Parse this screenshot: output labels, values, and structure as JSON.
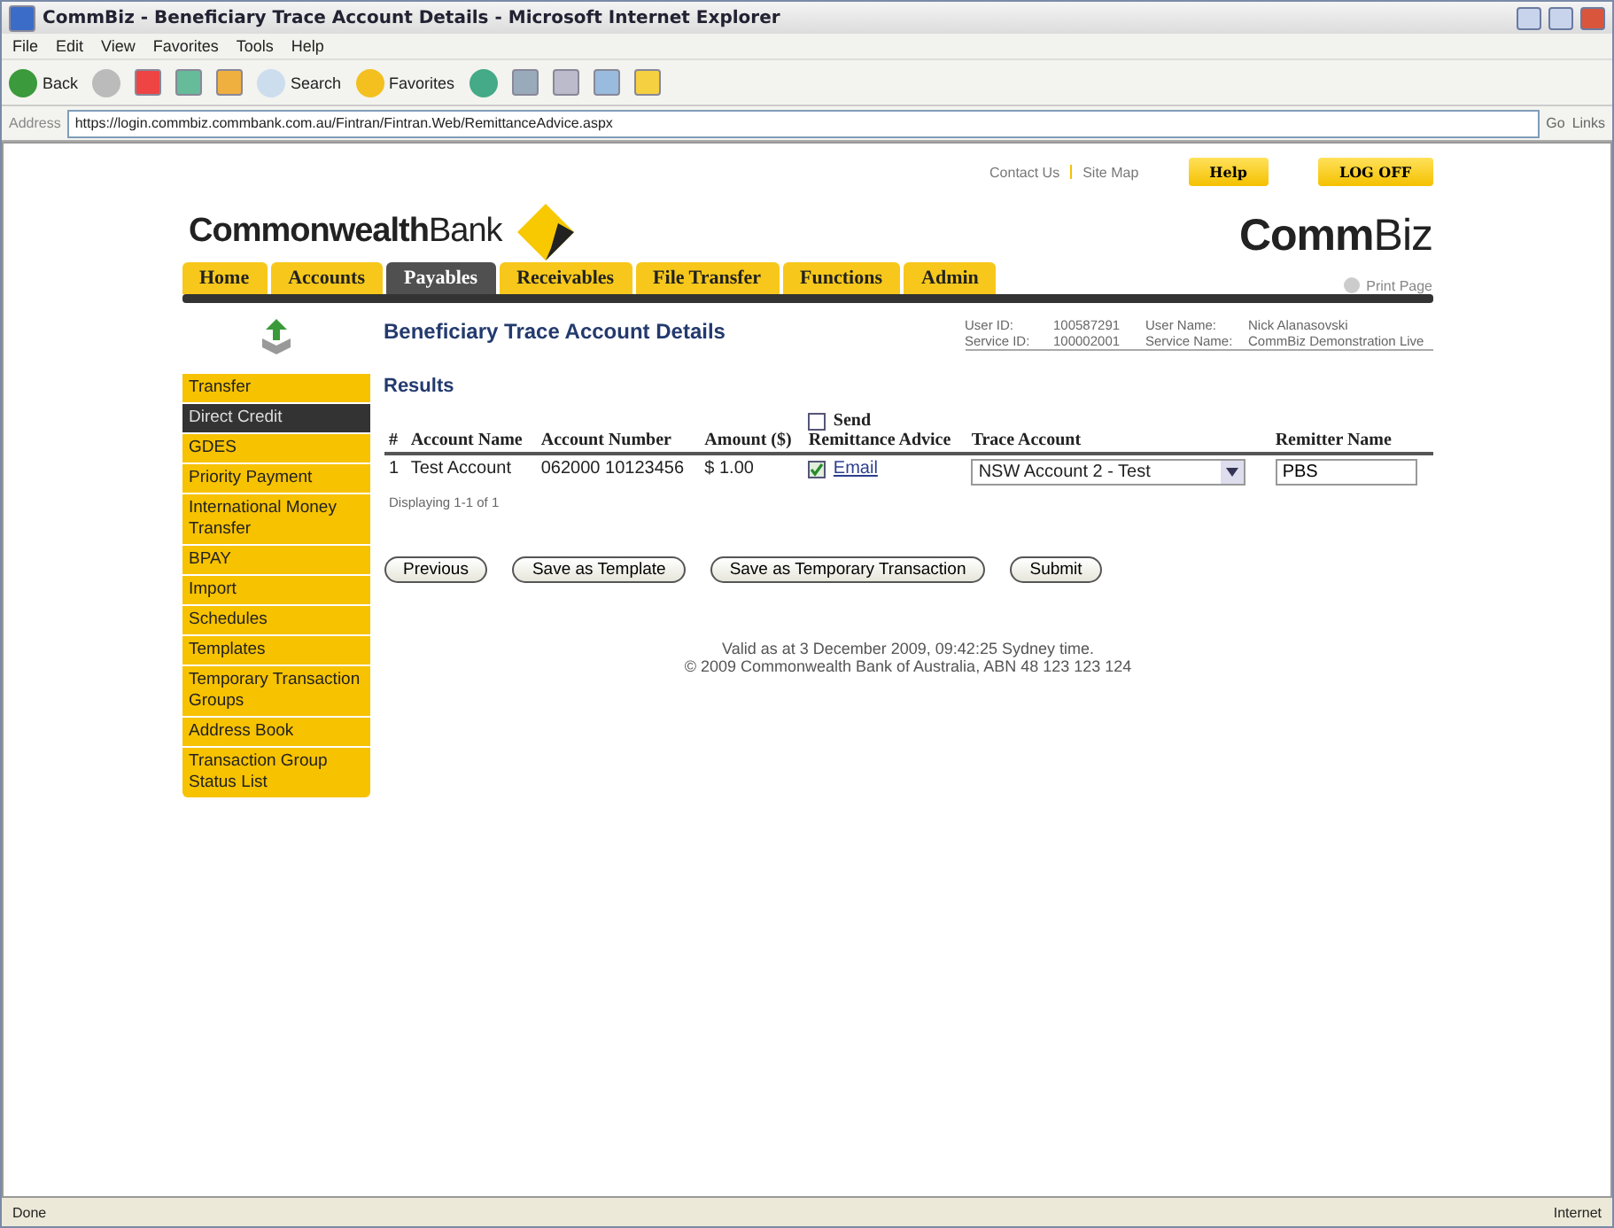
{
  "window": {
    "title": "CommBiz - Beneficiary Trace Account Details - Microsoft Internet Explorer"
  },
  "menu": [
    "File",
    "Edit",
    "View",
    "Favorites",
    "Tools",
    "Help"
  ],
  "toolbar": {
    "back": "Back",
    "search": "Search",
    "favorites": "Favorites"
  },
  "address": {
    "label": "Address",
    "url": "https://login.commbiz.commbank.com.au/Fintran/Fintran.Web/RemittanceAdvice.aspx",
    "go": "Go",
    "links": "Links"
  },
  "header": {
    "brand_bold": "Commonwealth",
    "brand_light": "Bank",
    "top_links": [
      "Contact Us",
      "Site Map"
    ],
    "buttons": [
      "Help",
      "LOG OFF"
    ],
    "product_bold": "Comm",
    "product_light": "Biz",
    "print": "Print Page"
  },
  "nav_tabs": [
    {
      "label": "Home",
      "selected": false
    },
    {
      "label": "Accounts",
      "selected": false
    },
    {
      "label": "Payables",
      "selected": true
    },
    {
      "label": "Receivables",
      "selected": false
    },
    {
      "label": "File Transfer",
      "selected": false
    },
    {
      "label": "Functions",
      "selected": false
    },
    {
      "label": "Admin",
      "selected": false
    }
  ],
  "user_info": [
    {
      "label": "User ID:",
      "value": "100587291",
      "label2": "User Name:",
      "value2": "Nick Alanasovski"
    },
    {
      "label": "Service ID:",
      "value": "100002001",
      "label2": "Service Name:",
      "value2": "CommBiz Demonstration Live"
    }
  ],
  "page_title": "Beneficiary Trace Account Details",
  "sidebar": [
    {
      "label": "Transfer",
      "selected": false
    },
    {
      "label": "Direct Credit",
      "selected": true
    },
    {
      "label": "GDES",
      "selected": false
    },
    {
      "label": "Priority Payment",
      "selected": false
    },
    {
      "label": "International Money Transfer",
      "selected": false
    },
    {
      "label": "BPAY",
      "selected": false
    },
    {
      "label": "Import",
      "selected": false
    },
    {
      "label": "Schedules",
      "selected": false
    },
    {
      "label": "Templates",
      "selected": false
    },
    {
      "label": "Temporary Transaction Groups",
      "selected": false
    },
    {
      "label": "Address Book",
      "selected": false
    },
    {
      "label": "Transaction Group Status List",
      "selected": false
    }
  ],
  "results": {
    "heading": "Results",
    "send_all": {
      "label": "Send",
      "checked": false
    },
    "columns": [
      "#",
      "Account Name",
      "Account Number",
      "Amount ($)",
      "Remittance Advice",
      "Trace Account",
      "Remitter Name"
    ],
    "rows": [
      {
        "index": "1",
        "account_name": "Test Account",
        "account_number": "062000 10123456",
        "amount": "$ 1.00",
        "remittance": {
          "label": "Email",
          "checked": true
        },
        "trace_account": "NSW Account 2 - Test",
        "remitter_name": "PBS"
      }
    ],
    "displaying": "Displaying 1-1 of 1"
  },
  "buttons": [
    "Previous",
    "Save as Template",
    "Save as Temporary Transaction",
    "Submit"
  ],
  "footer": [
    "Valid as at 3 December 2009, 09:42:25 Sydney time.",
    "© 2009 Commonwealth Bank of Australia, ABN 48 123 123 124"
  ],
  "status_bar": {
    "text": "Done",
    "zone": "Internet"
  }
}
